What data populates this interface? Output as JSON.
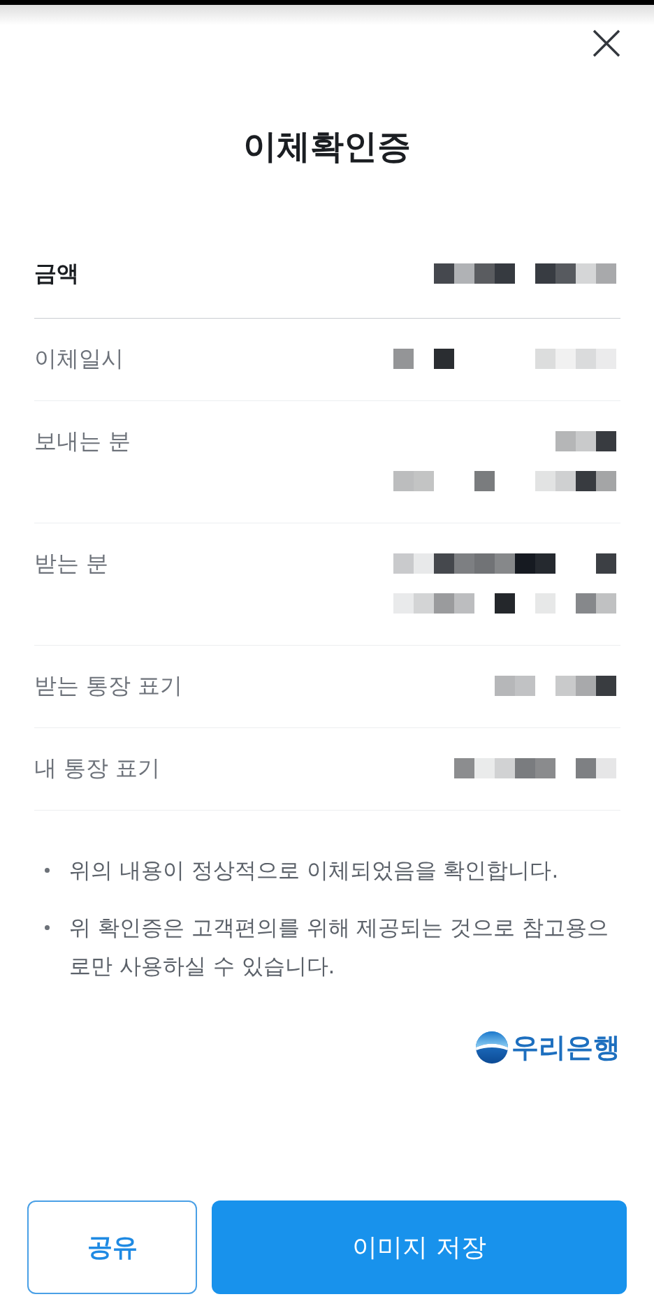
{
  "title": "이체확인증",
  "details": [
    {
      "kind": "primary",
      "label": "금액",
      "value_lines": [
        {
          "kind": "pixelated"
        }
      ]
    },
    {
      "kind": "secondary",
      "label": "이체일시",
      "value_lines": [
        {
          "kind": "pixelated"
        }
      ]
    },
    {
      "kind": "secondary",
      "label": "보내는 분",
      "value_lines": [
        {
          "kind": "pixelated"
        },
        {
          "kind": "pixelated"
        }
      ]
    },
    {
      "kind": "secondary",
      "label": "받는 분",
      "value_lines": [
        {
          "kind": "pixelated"
        },
        {
          "kind": "pixelated"
        }
      ]
    },
    {
      "kind": "secondary",
      "label": "받는 통장 표기",
      "value_lines": [
        {
          "kind": "pixelated"
        }
      ]
    },
    {
      "kind": "secondary",
      "label": "내 통장 표기",
      "value_lines": [
        {
          "kind": "pixelated"
        }
      ]
    }
  ],
  "notes": [
    "위의 내용이 정상적으로 이체되었음을 확인합니다.",
    "위 확인증은 고객편의를 위해 제공되는 것으로 참고용으로만 사용하실 수 있습니다."
  ],
  "bank_logo": {
    "text": "우리은행"
  },
  "buttons": [
    {
      "kind": "secondary",
      "label": "공유"
    },
    {
      "kind": "primary",
      "label": "이미지 저장"
    }
  ]
}
